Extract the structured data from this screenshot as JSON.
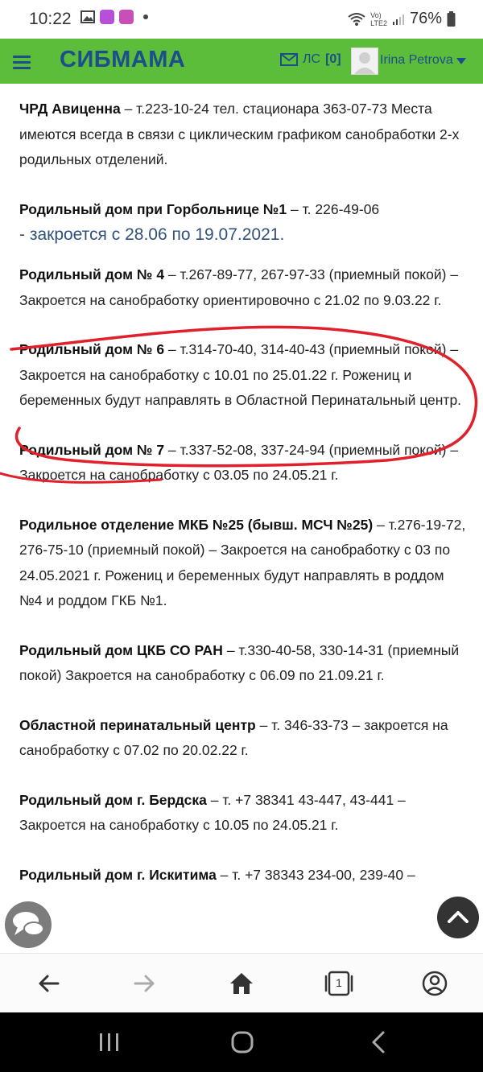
{
  "status": {
    "time": "10:22",
    "battery": "76%",
    "network_top": "Vo)",
    "network_bottom": "LTE2"
  },
  "header": {
    "brand": "СИБМАМА",
    "messages_label": "ЛС",
    "messages_count": "[0]",
    "user_name": "Irina Petrova"
  },
  "entries": [
    {
      "title": "ЧРД Авиценна",
      "text": " – т.223-10-24 тел. стационара 363-07-73 Места имеются всегда в связи с циклическим графиком санобработки 2-х родильных отделений."
    },
    {
      "title": "Родильный дом при Горбольнице №1",
      "text": " – т. 226-49-06",
      "note": "- закроется с 28.06 по 19.07.2021."
    },
    {
      "title": "Родильный дом № 4",
      "text": " – т.267-89-77, 267-97-33 (приемный покой) – Закроется на санобработку ориентировочно с 21.02 по 9.03.22 г."
    },
    {
      "title": "Родильный дом № 6",
      "text": " – т.314-70-40, 314-40-43 (приемный покой) – Закроется на санобработку  с 10.01 по 25.01.22 г. Рожениц и беременных будут направлять в Областной Перинатальный центр."
    },
    {
      "title": "Родильный дом № 7",
      "text": " – т.337-52-08, 337-24-94 (приемный покой) – Закроется на санобработку с 03.05 по 24.05.21 г."
    },
    {
      "title": "Родильное отделение МКБ №25 (бывш. МСЧ №25)",
      "text": " – т.276-19-72, 276-75-10 (приемный покой) –  Закроется на санобработку с 03 по 24.05.2021 г. Рожениц и беременных будут направлять в роддом №4 и роддом ГКБ №1."
    },
    {
      "title": "Родильный дом ЦКБ СО РАН",
      "text": " – т.330-40-58, 330-14-31 (приемный покой)  Закроется на санобработку с 06.09 по 21.09.21 г."
    },
    {
      "title": "Областной перинатальный центр",
      "text": " – т. 346-33-73 – закроется на санобработку с 07.02 по 20.02.22 г."
    },
    {
      "title": "Родильный дом г. Бердска",
      "text": " – т. +7 38341 43-447, 43-441 – Закроется на санобработку с 10.05 по 24.05.21 г."
    },
    {
      "title": "Родильный дом г. Искитима",
      "text": " – т. +7 38343 234-00, 239-40 –"
    }
  ],
  "browser_nav": {
    "tabs_count": "1"
  },
  "colors": {
    "header_bg": "#5bbd3a",
    "brand": "#1c4e8e",
    "circle": "#e0202a"
  }
}
